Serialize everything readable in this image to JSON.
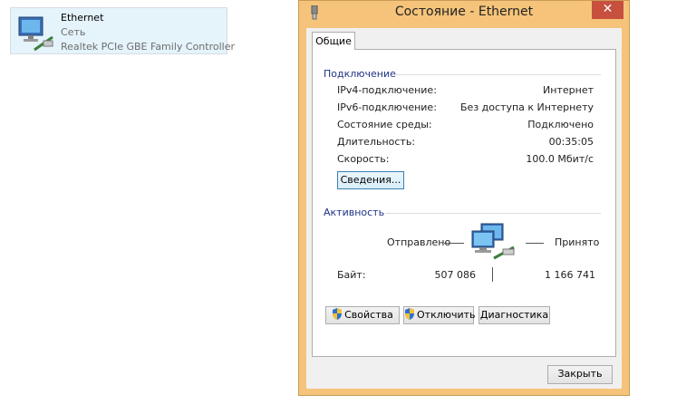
{
  "adapter": {
    "name": "Ethernet",
    "network": "Сеть",
    "device": "Realtek PCIe GBE Family Controller"
  },
  "dialog": {
    "title": "Состояние - Ethernet",
    "close_glyph": "✕",
    "tab": "Общие",
    "connection": {
      "heading": "Подключение",
      "rows": [
        {
          "label": "IPv4-подключение:",
          "value": "Интернет"
        },
        {
          "label": "IPv6-подключение:",
          "value": "Без доступа к Интернету"
        },
        {
          "label": "Состояние среды:",
          "value": "Подключено"
        },
        {
          "label": "Длительность:",
          "value": "00:35:05"
        },
        {
          "label": "Скорость:",
          "value": "100.0 Мбит/с"
        }
      ],
      "details_button": "Сведения..."
    },
    "activity": {
      "heading": "Активность",
      "sent_label": "Отправлено",
      "received_label": "Принято",
      "bytes_label": "Байт:",
      "bytes_sent": "507 086",
      "bytes_received": "1 166 741"
    },
    "buttons": {
      "properties": "Свойства",
      "disable": "Отключить",
      "diagnose": "Диагностика",
      "close": "Закрыть"
    }
  }
}
